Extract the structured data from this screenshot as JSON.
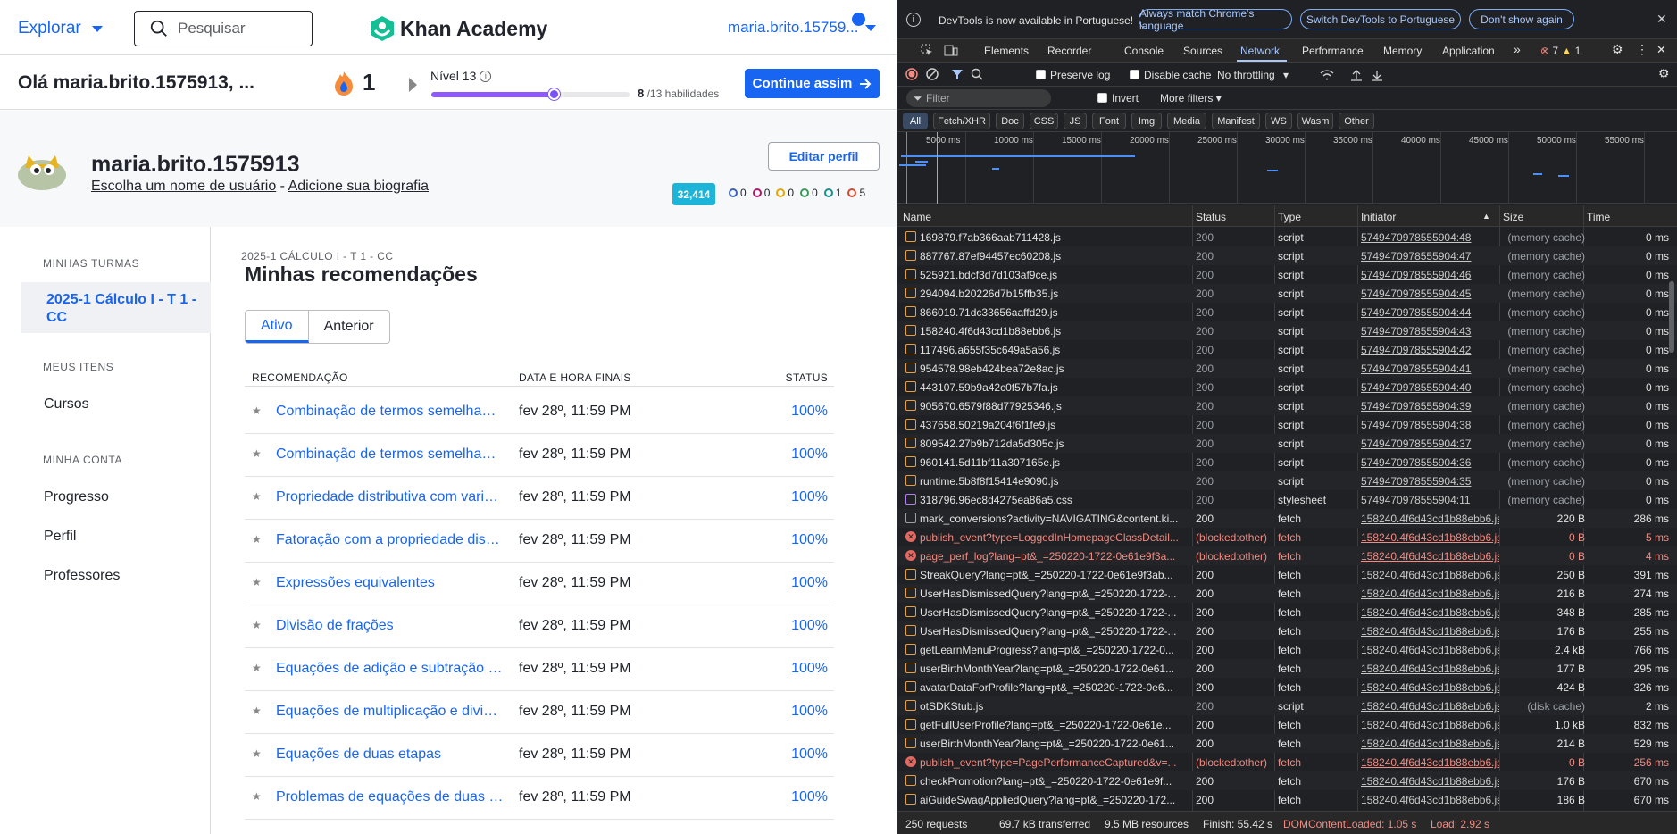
{
  "ka": {
    "explore_label": "Explorar",
    "search_placeholder": "Pesquisar",
    "brand": "Khan Academy",
    "user_menu": "maria.brito.15759...",
    "greeting": "Olá maria.brito.1575913, ...",
    "streak_count": "1",
    "level_label": "Nível 13",
    "level_progress": 0.615,
    "skills_done": "8",
    "skills_total": "/13 habilidades",
    "continue_label": "Continue assim",
    "profile_name": "maria.brito.1575913",
    "profile_link_username": "Escolha um nome de usuário",
    "profile_link_sep": " - ",
    "profile_link_bio": "Adicione sua biografia",
    "edit_profile": "Editar perfil",
    "points": "32,414",
    "badges": [
      {
        "count": "0",
        "color": "#3d63b8"
      },
      {
        "count": "0",
        "color": "#b3166e"
      },
      {
        "count": "0",
        "color": "#e5a600"
      },
      {
        "count": "0",
        "color": "#3a9a5b"
      },
      {
        "count": "1",
        "color": "#1a8f8f"
      },
      {
        "count": "5",
        "color": "#d44a2f"
      }
    ],
    "sidebar": {
      "classes_head": "MINHAS TURMAS",
      "active_class": "2025-1 Cálculo I - T 1 - CC",
      "items_head": "MEUS ITENS",
      "courses": "Cursos",
      "account_head": "MINHA CONTA",
      "progress": "Progresso",
      "profile": "Perfil",
      "teachers": "Professores"
    },
    "class_label": "2025-1 CÁLCULO I - T 1 - CC",
    "page_title": "Minhas recomendações",
    "tabs": [
      "Ativo",
      "Anterior"
    ],
    "table_headers": [
      "RECOMENDAÇÃO",
      "DATA E HORA FINAIS",
      "STATUS"
    ],
    "rows": [
      {
        "title": "Combinação de termos semelhantes",
        "due": "fev 28º, 11:59 PM",
        "status": "100%"
      },
      {
        "title": "Combinação de termos semelhantes",
        "due": "fev 28º, 11:59 PM",
        "status": "100%"
      },
      {
        "title": "Propriedade distributiva com variáveis",
        "due": "fev 28º, 11:59 PM",
        "status": "100%"
      },
      {
        "title": "Fatoração com a propriedade distributiva",
        "due": "fev 28º, 11:59 PM",
        "status": "100%"
      },
      {
        "title": "Expressões equivalentes",
        "due": "fev 28º, 11:59 PM",
        "status": "100%"
      },
      {
        "title": "Divisão de frações",
        "due": "fev 28º, 11:59 PM",
        "status": "100%"
      },
      {
        "title": "Equações de adição e subtração de uma etapa",
        "due": "fev 28º, 11:59 PM",
        "status": "100%"
      },
      {
        "title": "Equações de multiplicação e divisão",
        "due": "fev 28º, 11:59 PM",
        "status": "100%"
      },
      {
        "title": "Equações de duas etapas",
        "due": "fev 28º, 11:59 PM",
        "status": "100%"
      },
      {
        "title": "Problemas de equações de duas etapas",
        "due": "fev 28º, 11:59 PM",
        "status": "100%"
      }
    ],
    "colors": {
      "link": "#1865f2",
      "accent_purple": "#9059ff",
      "points_bg": "#1cb4d8"
    }
  },
  "devtools": {
    "info_message": "DevTools is now available in Portuguese!",
    "info_buttons": [
      "Always match Chrome's language",
      "Switch DevTools to Portuguese",
      "Don't show again"
    ],
    "tabs": [
      "Elements",
      "Recorder",
      "Console",
      "Sources",
      "Network",
      "Performance",
      "Memory",
      "Application"
    ],
    "active_tab": "Network",
    "error_count": "7",
    "warning_count": "1",
    "preserve_log": "Preserve log",
    "disable_cache": "Disable cache",
    "throttling": "No throttling",
    "filter_placeholder": "Filter",
    "invert": "Invert",
    "more_filters": "More filters",
    "type_filters": [
      "All",
      "Fetch/XHR",
      "Doc",
      "CSS",
      "JS",
      "Font",
      "Img",
      "Media",
      "Manifest",
      "WS",
      "Wasm",
      "Other"
    ],
    "timeline_ticks": [
      "5000 ms",
      "10000 ms",
      "15000 ms",
      "20000 ms",
      "25000 ms",
      "30000 ms",
      "35000 ms",
      "40000 ms",
      "45000 ms",
      "50000 ms",
      "55000 ms"
    ],
    "columns": [
      "Name",
      "Status",
      "Type",
      "Initiator",
      "Size",
      "Time"
    ],
    "requests": [
      {
        "name": "169879.f7ab366aab711428.js",
        "status": "200",
        "type": "script",
        "initiator": "574947097855590​4:48",
        "size": "(memory cache)",
        "time": "0 ms",
        "kind": "script"
      },
      {
        "name": "887767.87ef94457ec60208.js",
        "status": "200",
        "type": "script",
        "initiator": "5749470978555904:47",
        "size": "(memory cache)",
        "time": "0 ms",
        "kind": "script"
      },
      {
        "name": "525921.bdcf3d7d103af9ce.js",
        "status": "200",
        "type": "script",
        "initiator": "5749470978555904:46",
        "size": "(memory cache)",
        "time": "0 ms",
        "kind": "script"
      },
      {
        "name": "294094.b20226d7b15ffb35.js",
        "status": "200",
        "type": "script",
        "initiator": "5749470978555904:45",
        "size": "(memory cache)",
        "time": "0 ms",
        "kind": "script"
      },
      {
        "name": "866019.71dc33656aaffd29.js",
        "status": "200",
        "type": "script",
        "initiator": "5749470978555904:44",
        "size": "(memory cache)",
        "time": "0 ms",
        "kind": "script"
      },
      {
        "name": "158240.4f6d43cd1b88ebb6.js",
        "status": "200",
        "type": "script",
        "initiator": "5749470978555904:43",
        "size": "(memory cache)",
        "time": "0 ms",
        "kind": "script"
      },
      {
        "name": "117496.a655f35c649a5a56.js",
        "status": "200",
        "type": "script",
        "initiator": "5749470978555904:42",
        "size": "(memory cache)",
        "time": "0 ms",
        "kind": "script"
      },
      {
        "name": "954578.98eb424bea72e8ac.js",
        "status": "200",
        "type": "script",
        "initiator": "5749470978555904:41",
        "size": "(memory cache)",
        "time": "0 ms",
        "kind": "script"
      },
      {
        "name": "443107.59b9a42c0f57b7fa.js",
        "status": "200",
        "type": "script",
        "initiator": "5749470978555904:40",
        "size": "(memory cache)",
        "time": "0 ms",
        "kind": "script"
      },
      {
        "name": "905670.6579f88d77925346.js",
        "status": "200",
        "type": "script",
        "initiator": "5749470978555904:39",
        "size": "(memory cache)",
        "time": "0 ms",
        "kind": "script"
      },
      {
        "name": "437658.50219a204f6f1fe9.js",
        "status": "200",
        "type": "script",
        "initiator": "5749470978555904:38",
        "size": "(memory cache)",
        "time": "0 ms",
        "kind": "script"
      },
      {
        "name": "809542.27b9b712da5d305c.js",
        "status": "200",
        "type": "script",
        "initiator": "5749470978555904:37",
        "size": "(memory cache)",
        "time": "0 ms",
        "kind": "script"
      },
      {
        "name": "960141.5d11bf11a307165e.js",
        "status": "200",
        "type": "script",
        "initiator": "5749470978555904:36",
        "size": "(memory cache)",
        "time": "0 ms",
        "kind": "script"
      },
      {
        "name": "runtime.5b8f8f15414e9090.js",
        "status": "200",
        "type": "script",
        "initiator": "5749470978555904:35",
        "size": "(memory cache)",
        "time": "0 ms",
        "kind": "script"
      },
      {
        "name": "318796.96ec8d4275ea86a5.css",
        "status": "200",
        "type": "stylesheet",
        "initiator": "5749470978555904:11",
        "size": "(memory cache)",
        "time": "0 ms",
        "kind": "css"
      },
      {
        "name": "mark_conversions?activity=NAVIGATING&content.ki...",
        "status": "200",
        "type": "fetch",
        "initiator": "158240.4f6d43cd1b88ebb6.js",
        "size": "220 B",
        "time": "286 ms",
        "kind": "doc"
      },
      {
        "name": "publish_event?type=LoggedInHomepageClassDetail...",
        "status": "(blocked:other)",
        "type": "fetch",
        "initiator": "158240.4f6d43cd1b88ebb6.js",
        "size": "0 B",
        "time": "5 ms",
        "kind": "error"
      },
      {
        "name": "page_perf_log?lang=pt&_=250220-1722-0e61e9f3a...",
        "status": "(blocked:other)",
        "type": "fetch",
        "initiator": "158240.4f6d43cd1b88ebb6.js",
        "size": "0 B",
        "time": "4 ms",
        "kind": "error"
      },
      {
        "name": "StreakQuery?lang=pt&_=250220-1722-0e61e9f3ab...",
        "status": "200",
        "type": "fetch",
        "initiator": "158240.4f6d43cd1b88ebb6.js",
        "size": "250 B",
        "time": "391 ms",
        "kind": "fetch"
      },
      {
        "name": "UserHasDismissedQuery?lang=pt&_=250220-1722-...",
        "status": "200",
        "type": "fetch",
        "initiator": "158240.4f6d43cd1b88ebb6.js",
        "size": "216 B",
        "time": "274 ms",
        "kind": "fetch"
      },
      {
        "name": "UserHasDismissedQuery?lang=pt&_=250220-1722-...",
        "status": "200",
        "type": "fetch",
        "initiator": "158240.4f6d43cd1b88ebb6.js",
        "size": "348 B",
        "time": "285 ms",
        "kind": "fetch"
      },
      {
        "name": "UserHasDismissedQuery?lang=pt&_=250220-1722-...",
        "status": "200",
        "type": "fetch",
        "initiator": "158240.4f6d43cd1b88ebb6.js",
        "size": "176 B",
        "time": "255 ms",
        "kind": "fetch"
      },
      {
        "name": "getLearnMenuProgress?lang=pt&_=250220-1722-0...",
        "status": "200",
        "type": "fetch",
        "initiator": "158240.4f6d43cd1b88ebb6.js",
        "size": "2.4 kB",
        "time": "766 ms",
        "kind": "fetch"
      },
      {
        "name": "userBirthMonthYear?lang=pt&_=250220-1722-0e61...",
        "status": "200",
        "type": "fetch",
        "initiator": "158240.4f6d43cd1b88ebb6.js",
        "size": "177 B",
        "time": "295 ms",
        "kind": "fetch"
      },
      {
        "name": "avatarDataForProfile?lang=pt&_=250220-1722-0e6...",
        "status": "200",
        "type": "fetch",
        "initiator": "158240.4f6d43cd1b88ebb6.js",
        "size": "424 B",
        "time": "326 ms",
        "kind": "fetch"
      },
      {
        "name": "otSDKStub.js",
        "status": "200",
        "type": "script",
        "initiator": "158240.4f6d43cd1b88ebb6.js",
        "size": "(disk cache)",
        "time": "2 ms",
        "kind": "script"
      },
      {
        "name": "getFullUserProfile?lang=pt&_=250220-1722-0e61e...",
        "status": "200",
        "type": "fetch",
        "initiator": "158240.4f6d43cd1b88ebb6.js",
        "size": "1.0 kB",
        "time": "832 ms",
        "kind": "fetch"
      },
      {
        "name": "userBirthMonthYear?lang=pt&_=250220-1722-0e61...",
        "status": "200",
        "type": "fetch",
        "initiator": "158240.4f6d43cd1b88ebb6.js",
        "size": "214 B",
        "time": "529 ms",
        "kind": "fetch"
      },
      {
        "name": "publish_event?type=PagePerformanceCaptured&v=...",
        "status": "(blocked:other)",
        "type": "fetch",
        "initiator": "158240.4f6d43cd1b88ebb6.js",
        "size": "0 B",
        "time": "256 ms",
        "kind": "error"
      },
      {
        "name": "checkPromotion?lang=pt&_=250220-1722-0e61e9f...",
        "status": "200",
        "type": "fetch",
        "initiator": "158240.4f6d43cd1b88ebb6.js",
        "size": "176 B",
        "time": "670 ms",
        "kind": "fetch"
      },
      {
        "name": "aiGuideSwagAppliedQuery?lang=pt&_=250220-172...",
        "status": "200",
        "type": "fetch",
        "initiator": "158240.4f6d43cd1b88ebb6.js",
        "size": "186 B",
        "time": "670 ms",
        "kind": "fetch"
      }
    ],
    "status_bar": {
      "requests": "250 requests",
      "transferred": "69.7 kB transferred",
      "resources": "9.5 MB resources",
      "finish": "Finish: 55.42 s",
      "dom_loaded": "DOMContentLoaded: 1.05 s",
      "load": "Load: 2.92 s"
    },
    "colors": {
      "accent": "#a8c7fa",
      "error": "#f28b82",
      "dom_loaded": "#f28b82",
      "load": "#f28b82"
    }
  }
}
